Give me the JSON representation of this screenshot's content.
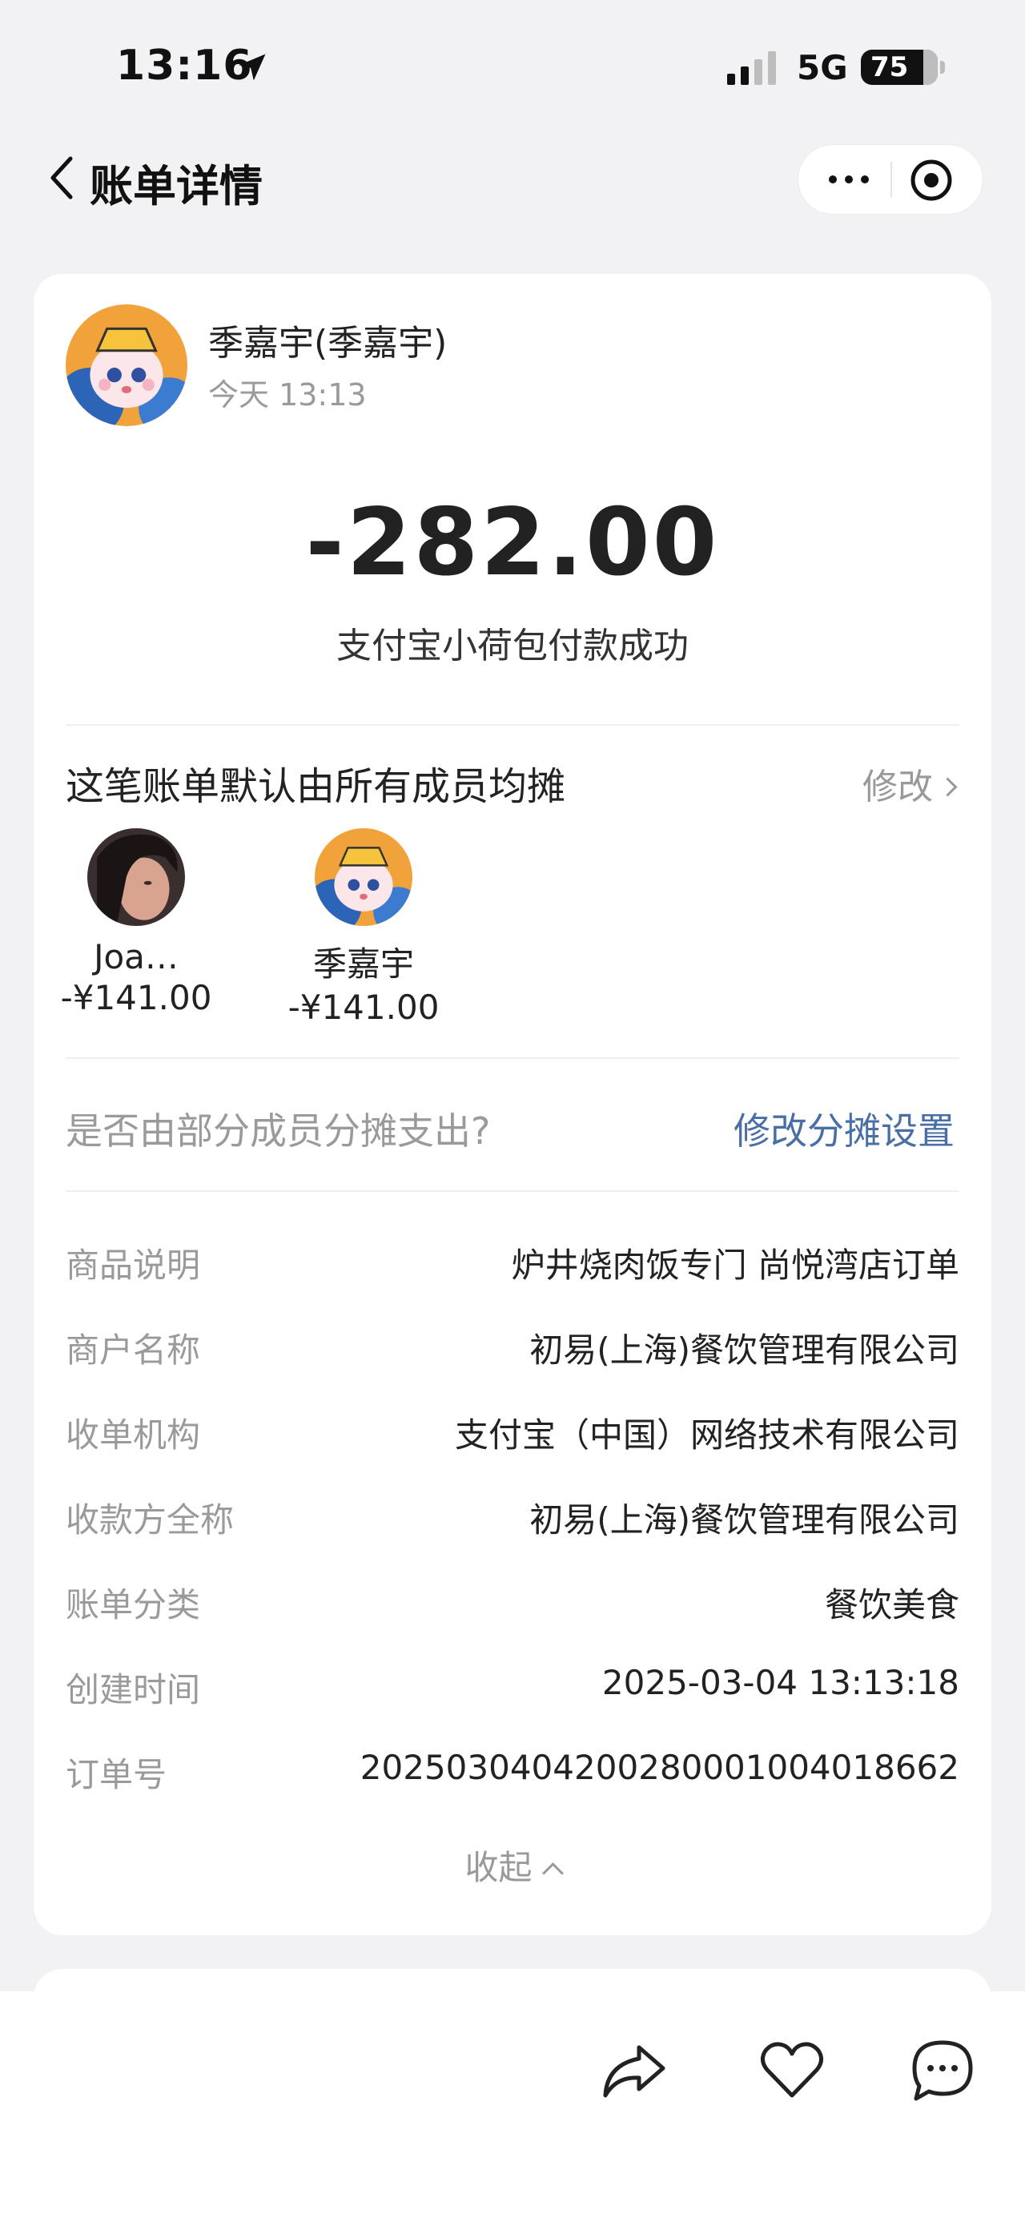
{
  "status_bar": {
    "time": "13:16",
    "network": "5G",
    "battery": "75"
  },
  "header": {
    "title": "账单详情"
  },
  "payer": {
    "name": "季嘉宇(季嘉宇)",
    "time": "今天 13:13"
  },
  "transaction": {
    "amount": "-282.00",
    "status": "支付宝小荷包付款成功"
  },
  "split": {
    "title": "这笔账单默认由所有成员均摊",
    "edit_label": "修改",
    "members": [
      {
        "name": "Joa…",
        "amount": "-¥141.00"
      },
      {
        "name": "季嘉宇",
        "amount": "-¥141.00"
      }
    ],
    "partial_question": "是否由部分成员分摊支出?",
    "partial_link": "修改分摊设置"
  },
  "details": [
    {
      "label": "商品说明",
      "value": "炉井烧肉饭专门 尚悦湾店订单"
    },
    {
      "label": "商户名称",
      "value": "初易(上海)餐饮管理有限公司"
    },
    {
      "label": "收单机构",
      "value": "支付宝（中国）网络技术有限公司"
    },
    {
      "label": "收款方全称",
      "value": "初易(上海)餐饮管理有限公司"
    },
    {
      "label": "账单分类",
      "value": "餐饮美食"
    },
    {
      "label": "创建时间",
      "value": "2025-03-04 13:13:18"
    },
    {
      "label": "订单号",
      "value": "2025030404200280001004018662"
    }
  ],
  "collapse_label": "收起",
  "bottom_actions": [
    "share-icon",
    "like-icon",
    "comment-icon"
  ],
  "colors": {
    "background": "#f2f2f4",
    "card": "#ffffff",
    "link": "#4a6fa5",
    "muted": "#9a9a9a"
  }
}
